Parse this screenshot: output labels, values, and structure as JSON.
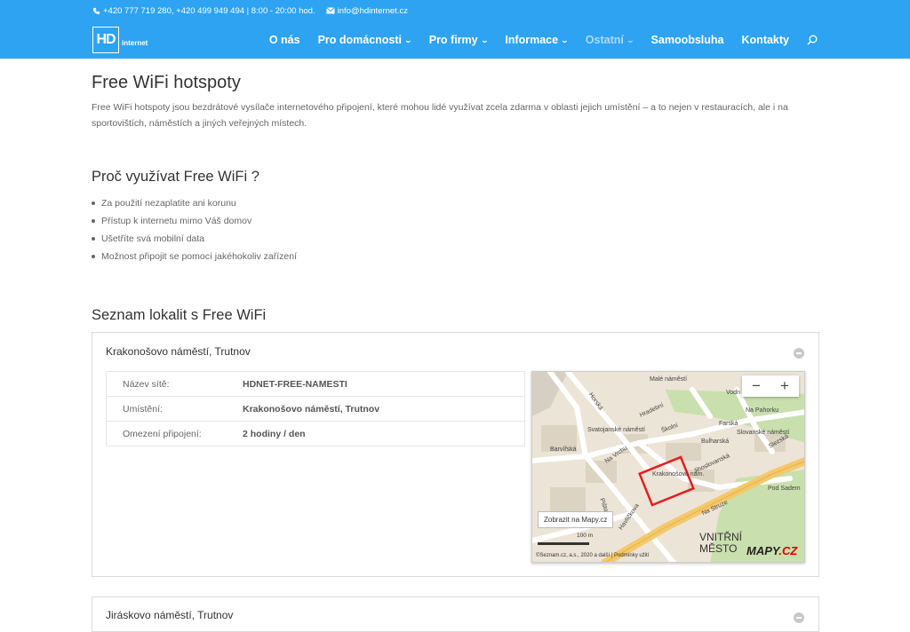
{
  "topbar": {
    "phone": "+420 777 719 280, +420 499 949 494 | 8:00 - 20:00 hod.",
    "email": "info@hdinternet.cz"
  },
  "logo": {
    "mark": "HD",
    "text": "internet"
  },
  "menu": [
    {
      "label": "O nás"
    },
    {
      "label": "Pro domácnosti"
    },
    {
      "label": "Pro firmy"
    },
    {
      "label": "Informace"
    },
    {
      "label": "Ostatní"
    },
    {
      "label": "Samoobsluha"
    },
    {
      "label": "Kontakty"
    }
  ],
  "page": {
    "title": "Free WiFi hotspoty",
    "intro": "Free WiFi hotspoty jsou bezdrátové vysílače internetového připojení, které mohou lidé využívat zcela zdarma v oblasti jejich umístění – a to nejen v restauracích, ale i na sportovištích, náměstích a jiných veřejných místech.",
    "why_title": "Proč využívat Free WiFi ?",
    "bullets": [
      "Za použití nezaplatite ani korunu",
      "Přístup k internetu mimo Váš domov",
      "Ušetříte svá mobilní data",
      "Možnost připojit se pomocí jakéhokoliv zařízení"
    ],
    "list_title": "Seznam lokalit s Free WiFi"
  },
  "location": {
    "heading": "Krakonošovo náměstí, Trutnov",
    "rows": [
      {
        "key": "Název sítě:",
        "value": "HDNET-FREE-NAMESTI"
      },
      {
        "key": "Umístění:",
        "value": "Krakonošovo náměstí, Trutnov"
      },
      {
        "key": "Omezení připojení:",
        "value": "2 hodiny / den"
      }
    ]
  },
  "map": {
    "zoom_out": "−",
    "zoom_in": "+",
    "show_button": "Zobrazit na Mapy.cz",
    "district_line1": "VNITŘNÍ",
    "district_line2": "MĚSTO",
    "brand_main": "MAPY",
    "brand_suffix": ".CZ",
    "copyright": "©Seznam.cz, a.s., 2020 a další | Podmínky užití",
    "scale": "100 m",
    "labels": {
      "male_namesti": "Malé náměstí",
      "vodn": "Vodn",
      "na_pahorku": "Na Pahorku",
      "farska": "Farská",
      "hradebni": "Hradební",
      "svatojanske": "Svatojanské náměstí",
      "skolni": "Školní",
      "slovanske": "Slovanské náměstí",
      "bulharska": "Bulharská",
      "barvirska": "Barvířská",
      "na_vrchu": "Na Vrchu",
      "jihoslovanska": "Jihoslovanská",
      "krakonosovo": "Krakonošovo nám.",
      "pod_sadem": "Pod Sadem",
      "na_struze": "Na Struze",
      "havlickova": "Havlíčkova",
      "pistova": "Pištova",
      "hopska": "Horská",
      "slezska": "Slezská"
    }
  },
  "next_location": {
    "heading": "Jiráskovo náměstí, Trutnov"
  }
}
